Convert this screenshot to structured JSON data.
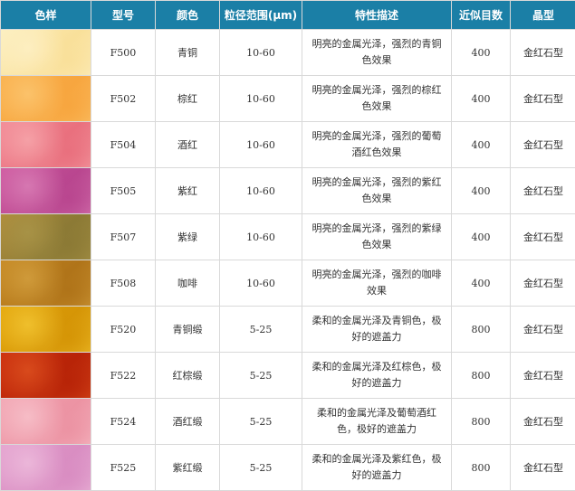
{
  "headers": [
    "色样",
    "型号",
    "颜色",
    "粒径范围(μm)",
    "特性描述",
    "近似目数",
    "晶型"
  ],
  "rows": [
    {
      "model": "F500",
      "color": "青铜",
      "size": "10-60",
      "desc": "明亮的金属光泽，强烈的青铜色效果",
      "mesh": "400",
      "crystal": "金红石型",
      "swatch": [
        "#fcf0c2",
        "#f9e09a",
        "#fdeec0"
      ]
    },
    {
      "model": "F502",
      "color": "棕红",
      "size": "10-60",
      "desc": "明亮的金属光泽，强烈的棕红色效果",
      "mesh": "400",
      "crystal": "金红石型",
      "swatch": [
        "#f9b14e",
        "#f7a63f",
        "#fbc26a"
      ]
    },
    {
      "model": "F504",
      "color": "酒红",
      "size": "10-60",
      "desc": "明亮的金属光泽，强烈的葡萄酒红色效果",
      "mesh": "400",
      "crystal": "金红石型",
      "swatch": [
        "#f28a96",
        "#e9707e",
        "#f5a0a6"
      ]
    },
    {
      "model": "F505",
      "color": "紫红",
      "size": "10-60",
      "desc": "明亮的金属光泽，强烈的紫红色效果",
      "mesh": "400",
      "crystal": "金红石型",
      "swatch": [
        "#cf5aa0",
        "#b9468f",
        "#d677b1"
      ]
    },
    {
      "model": "F507",
      "color": "紫绿",
      "size": "10-60",
      "desc": "明亮的金属光泽，强烈的紫绿色效果",
      "mesh": "400",
      "crystal": "金红石型",
      "swatch": [
        "#b28d3a",
        "#8c7a35",
        "#a79246"
      ]
    },
    {
      "model": "F508",
      "color": "咖啡",
      "size": "10-60",
      "desc": "明亮的金属光泽，强烈的咖啡效果",
      "mesh": "400",
      "crystal": "金红石型",
      "swatch": [
        "#c78a23",
        "#b07419",
        "#cf9a3a"
      ]
    },
    {
      "model": "F520",
      "color": "青铜缎",
      "size": "5-25",
      "desc": "柔和的金属光泽及青铜色，极好的遮盖力",
      "mesh": "800",
      "crystal": "金红石型",
      "swatch": [
        "#e4a70c",
        "#d59506",
        "#efbf2c"
      ]
    },
    {
      "model": "F522",
      "color": "红棕缎",
      "size": "5-25",
      "desc": "柔和的金属光泽及红棕色，极好的遮盖力",
      "mesh": "800",
      "crystal": "金红石型",
      "swatch": [
        "#cc2f0e",
        "#b82408",
        "#d84a1c"
      ]
    },
    {
      "model": "F524",
      "color": "酒红缎",
      "size": "5-25",
      "desc": "柔和的金属光泽及葡萄酒红色，极好的遮盖力",
      "mesh": "800",
      "crystal": "金红石型",
      "swatch": [
        "#f2a7b4",
        "#ec93a3",
        "#f6bcc6"
      ]
    },
    {
      "model": "F525",
      "color": "紫红缎",
      "size": "5-25",
      "desc": "柔和的金属光泽及紫红色，极好的遮盖力",
      "mesh": "800",
      "crystal": "金红石型",
      "swatch": [
        "#e4a3cf",
        "#d98dc2",
        "#ebb6d9"
      ]
    }
  ]
}
